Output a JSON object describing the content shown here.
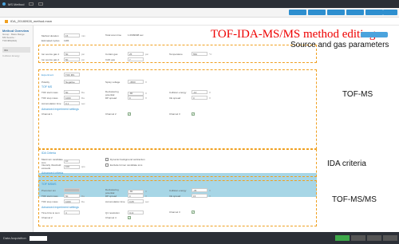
{
  "window": {
    "title": "MS Method"
  },
  "toolbar": {
    "buttons": [
      "",
      "",
      "",
      "",
      "",
      ""
    ]
  },
  "path": {
    "text": "IDA_20180928_method.msm"
  },
  "left_panel": {
    "title": "Method Overview",
    "lines": [
      "Group : Mass Range",
      "MS Source : TOF/MS(IDA)"
    ],
    "item": "IDA",
    "item2": "Collision Energy"
  },
  "heading": {
    "title": "TOF-IDA-MS/MS  method editing"
  },
  "top_button": {
    "label": ""
  },
  "sections": {
    "source": {
      "label": "Source and gas parameters"
    },
    "tofms": {
      "label": "TOF-MS"
    },
    "ida": {
      "label": "IDA criteria"
    },
    "tofmsms": {
      "label": "TOF-MS/MS"
    }
  },
  "fields": {
    "method_duration": {
      "label": "Method duration",
      "value": "15",
      "unit": "min"
    },
    "total_scan_time": {
      "label": "Total scan time",
      "value": "1.0699998 sec"
    },
    "estimated_cycles": {
      "label": "Estimated cycles",
      "value": "1184"
    },
    "ion_source_gas1": {
      "label": "Ion source gas 1",
      "value": "50",
      "unit": "psi"
    },
    "curtain_gas": {
      "label": "Curtain gas",
      "value": "25",
      "unit": "psi"
    },
    "temperature": {
      "label": "Temperature",
      "value": "550",
      "unit": "°C"
    },
    "ion_source_gas2": {
      "label": "Ion source gas 2",
      "value": "50",
      "unit": "psi"
    },
    "cad_gas": {
      "label": "CAD gas",
      "value": "7"
    },
    "experiment": {
      "label": "Experiment",
      "value": "TOF MS"
    },
    "polarity": {
      "label": "Polarity",
      "value": "Negative"
    },
    "spray_voltage": {
      "label": "Spray voltage",
      "value": "-4500",
      "unit": "V"
    },
    "tof_start": {
      "label": "TOF start mass",
      "value": "50",
      "unit": "Da"
    },
    "declustering": {
      "label": "Declustering potential",
      "value": "-80",
      "unit": "V"
    },
    "collision_energy": {
      "label": "Collision energy",
      "value": "-10",
      "unit": "V"
    },
    "tof_stop": {
      "label": "TOF stop mass",
      "value": "1000",
      "unit": "Da"
    },
    "dp_spread": {
      "label": "DP spread",
      "value": "0",
      "unit": "V"
    },
    "ce_spread": {
      "label": "CE spread",
      "value": "0",
      "unit": "V"
    },
    "accumulation": {
      "label": "Accumulation time",
      "value": "0.1",
      "unit": "sec"
    },
    "ida_max_candidate": {
      "label": "Maximum candidate ions",
      "value": "10"
    },
    "ida_intensity": {
      "label": "Intensity threshold exceeds",
      "value": "100",
      "unit": "cps"
    },
    "ida_dynamic_bg": {
      "label": "Dynamic background subtraction"
    },
    "ida_exclude": {
      "label": "Exclude former candidate ions"
    },
    "msms_precursor": {
      "label": "Precursor ion",
      "value": ""
    },
    "msms_declustering": {
      "label": "Declustering potential",
      "value": "-80",
      "unit": "V"
    },
    "msms_collision": {
      "label": "Collision energy",
      "value": "-35",
      "unit": "V"
    },
    "msms_tof_start": {
      "label": "TOF start mass",
      "value": "50",
      "unit": "Da"
    },
    "msms_dp_spread": {
      "label": "DP spread",
      "value": "0",
      "unit": "V"
    },
    "msms_ce_spread": {
      "label": "CE spread",
      "value": "15",
      "unit": "V"
    },
    "msms_tof_stop": {
      "label": "TOF stop mass",
      "value": "1000",
      "unit": "Da"
    },
    "msms_accum": {
      "label": "Accumulation time",
      "value": "0.05",
      "unit": "sec"
    },
    "msms_time_bins": {
      "label": "Time bins to sum",
      "value": "4"
    },
    "msms_q1": {
      "label": "Q1 resolution",
      "value": "Unit"
    },
    "msms_channel1": {
      "label": "Channel 1"
    },
    "msms_channel2": {
      "label": "Channel 2"
    },
    "msms_channel3": {
      "label": "Channel 3"
    },
    "msms_channel4": {
      "label": "Channel 4"
    }
  },
  "sub_headings": {
    "tofms_head": "TOF MS",
    "advanced1": "Advanced experiment settings",
    "ida_head": "IDA Criteria",
    "advanced_ida": "Advanced criteria",
    "msms_head": "TOF MSMS",
    "advanced2": "Advanced experiment settings"
  },
  "statusbar": {
    "label": "Data Acquisition"
  }
}
